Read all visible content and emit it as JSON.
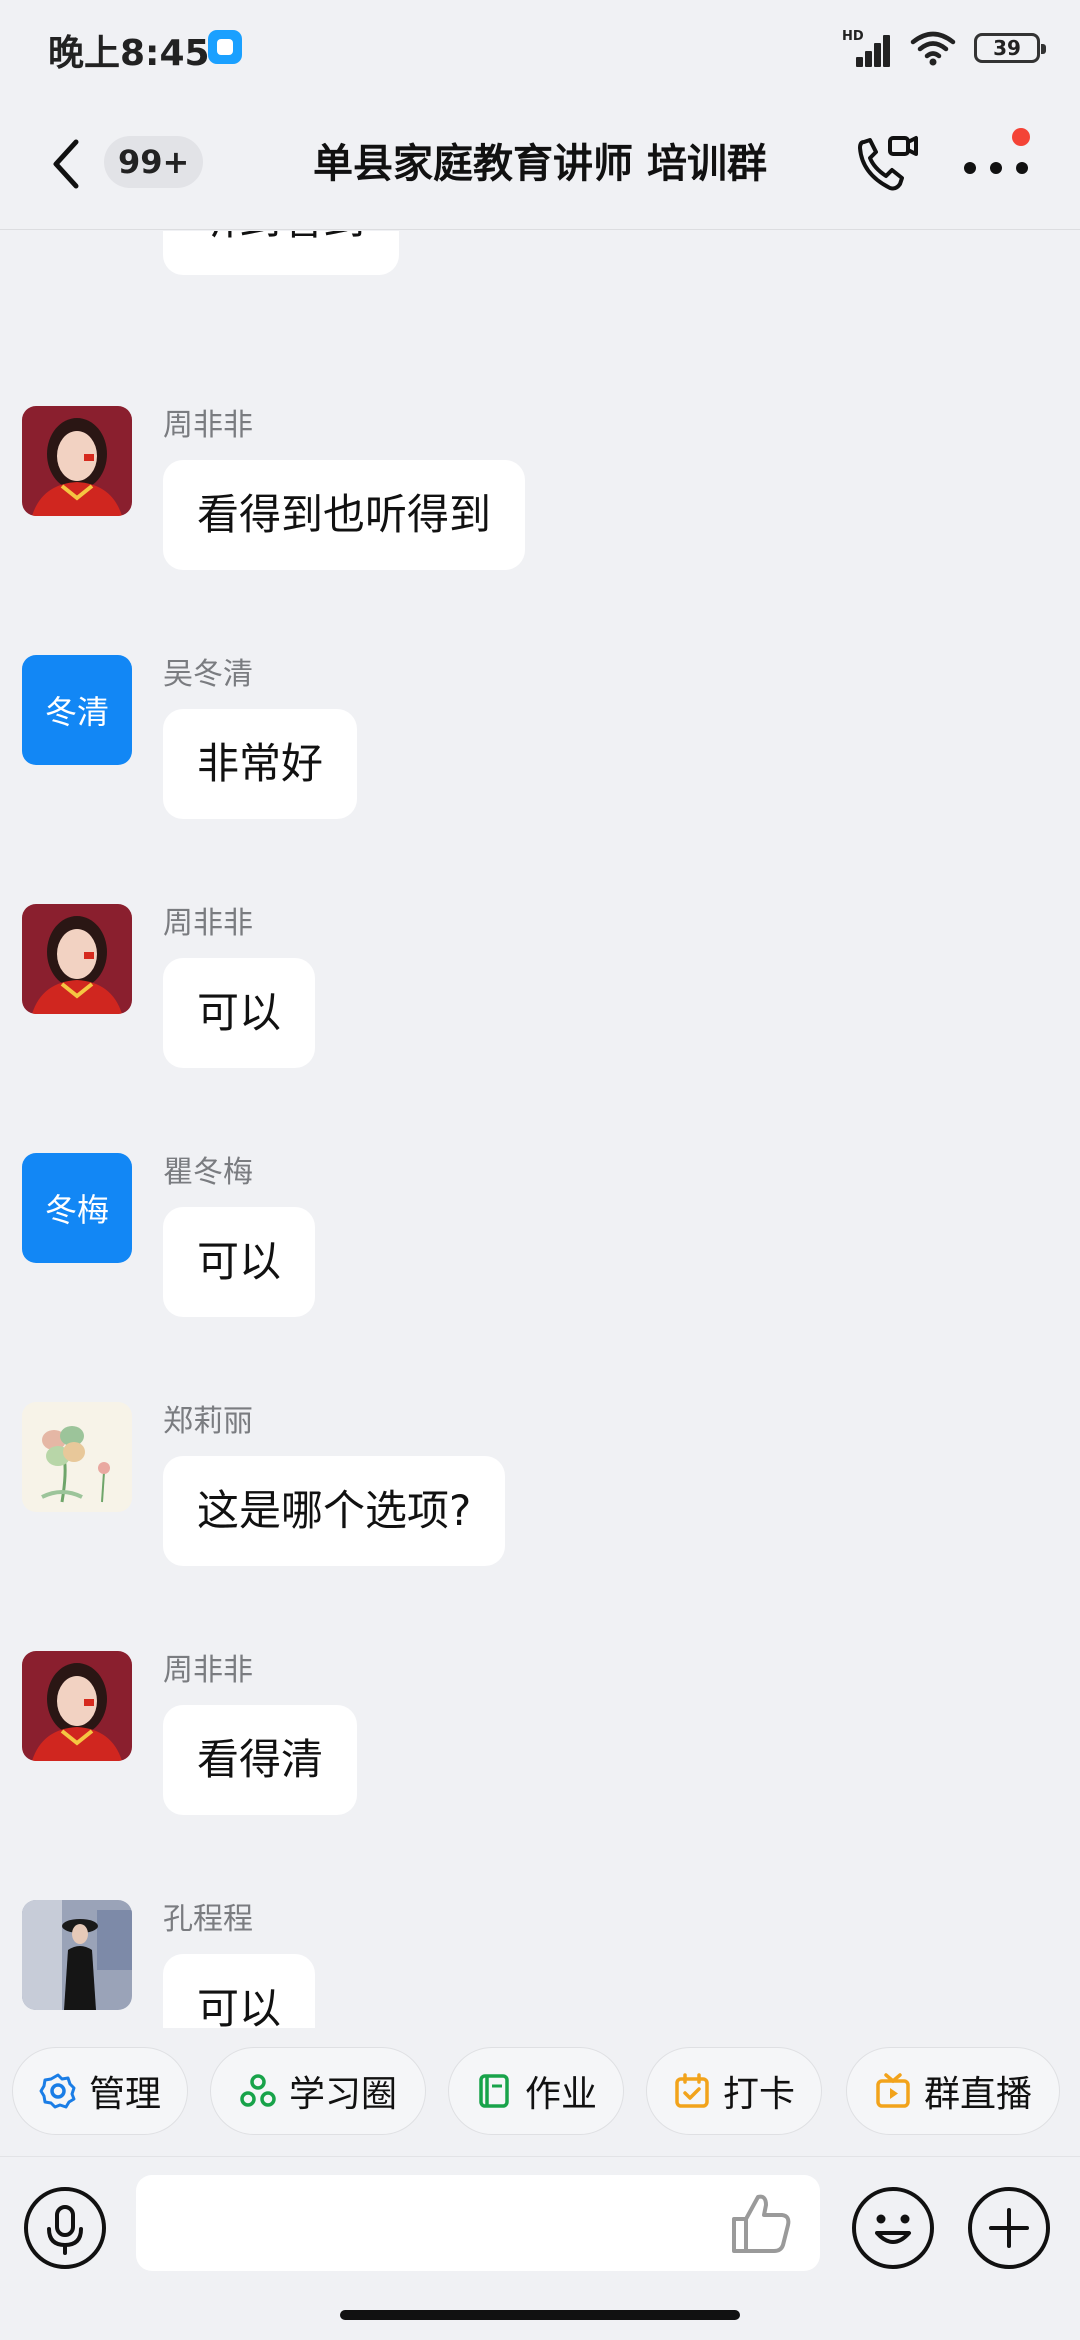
{
  "status_bar": {
    "time": "晚上8:45",
    "battery": "39",
    "signal_label": "HD"
  },
  "header": {
    "unread_count": "99+",
    "title": "单县家庭教育讲师 培训群"
  },
  "messages": [
    {
      "sender": "",
      "text": "听到看到",
      "avatar": "blue-square"
    },
    {
      "sender": "周非非",
      "text": "看得到也听得到",
      "avatar": "photo-woman-red"
    },
    {
      "sender": "吴冬清",
      "text": "非常好",
      "avatar_text": "冬清"
    },
    {
      "sender": "周非非",
      "text": "可以",
      "avatar": "photo-woman-red"
    },
    {
      "sender": "瞿冬梅",
      "text": "可以",
      "avatar_text": "冬梅"
    },
    {
      "sender": "郑莉丽",
      "text": "这是哪个选项?",
      "avatar": "clover-illustration"
    },
    {
      "sender": "周非非",
      "text": "看得清",
      "avatar": "photo-woman-red"
    },
    {
      "sender": "孔程程",
      "text": "可以",
      "avatar": "photo-woman-black"
    }
  ],
  "quick_actions": [
    {
      "label": "管理",
      "icon": "gear-icon"
    },
    {
      "label": "学习圈",
      "icon": "circle-group-icon"
    },
    {
      "label": "作业",
      "icon": "book-icon"
    },
    {
      "label": "打卡",
      "icon": "calendar-check-icon"
    },
    {
      "label": "群直播",
      "icon": "tv-play-icon"
    }
  ],
  "input": {
    "placeholder": ""
  },
  "colors": {
    "background": "#f0f1f4",
    "avatar_blue": "#1287f5",
    "notification_red": "#f44336",
    "gear_blue": "#1a7de6",
    "green": "#18a34a",
    "orange": "#f2a31b"
  }
}
